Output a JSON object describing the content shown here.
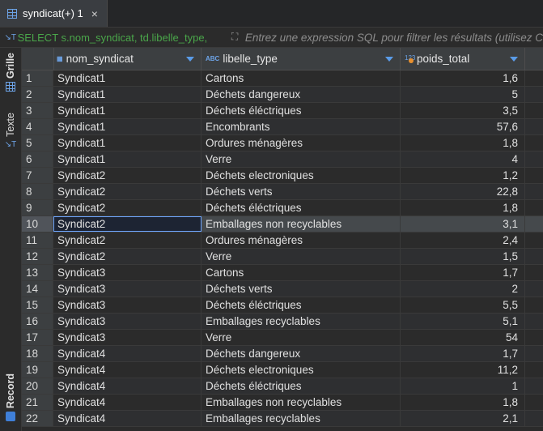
{
  "tab": {
    "title": "syndicat(+) 1",
    "close": "×"
  },
  "filter": {
    "sql": "SELECT s.nom_syndicat, td.libelle_type,",
    "placeholder": "Entrez une expression SQL pour filtrer les résultats (utilisez C"
  },
  "rail": {
    "grid_label": "Grille",
    "text_label": "Texte",
    "record_label": "Record"
  },
  "columns": [
    {
      "name": "nom_syndicat",
      "type_badge": ""
    },
    {
      "name": "libelle_type",
      "type_badge": "ABC"
    },
    {
      "name": "poids_total",
      "type_badge": "123"
    }
  ],
  "rows": [
    {
      "n": "1",
      "syndicat": "Syndicat1",
      "type": "Cartons",
      "poids": "1,6"
    },
    {
      "n": "2",
      "syndicat": "Syndicat1",
      "type": "Déchets dangereux",
      "poids": "5"
    },
    {
      "n": "3",
      "syndicat": "Syndicat1",
      "type": "Déchets éléctriques",
      "poids": "3,5"
    },
    {
      "n": "4",
      "syndicat": "Syndicat1",
      "type": "Encombrants",
      "poids": "57,6"
    },
    {
      "n": "5",
      "syndicat": "Syndicat1",
      "type": "Ordures ménagères",
      "poids": "1,8"
    },
    {
      "n": "6",
      "syndicat": "Syndicat1",
      "type": "Verre",
      "poids": "4"
    },
    {
      "n": "7",
      "syndicat": "Syndicat2",
      "type": "Déchets electroniques",
      "poids": "1,2"
    },
    {
      "n": "8",
      "syndicat": "Syndicat2",
      "type": "Déchets verts",
      "poids": "22,8"
    },
    {
      "n": "9",
      "syndicat": "Syndicat2",
      "type": "Déchets éléctriques",
      "poids": "1,8"
    },
    {
      "n": "10",
      "syndicat": "Syndicat2",
      "type": "Emballages non recyclables",
      "poids": "3,1"
    },
    {
      "n": "11",
      "syndicat": "Syndicat2",
      "type": "Ordures ménagères",
      "poids": "2,4"
    },
    {
      "n": "12",
      "syndicat": "Syndicat2",
      "type": "Verre",
      "poids": "1,5"
    },
    {
      "n": "13",
      "syndicat": "Syndicat3",
      "type": "Cartons",
      "poids": "1,7"
    },
    {
      "n": "14",
      "syndicat": "Syndicat3",
      "type": "Déchets verts",
      "poids": "2"
    },
    {
      "n": "15",
      "syndicat": "Syndicat3",
      "type": "Déchets éléctriques",
      "poids": "5,5"
    },
    {
      "n": "16",
      "syndicat": "Syndicat3",
      "type": "Emballages recyclables",
      "poids": "5,1"
    },
    {
      "n": "17",
      "syndicat": "Syndicat3",
      "type": "Verre",
      "poids": "54"
    },
    {
      "n": "18",
      "syndicat": "Syndicat4",
      "type": "Déchets dangereux",
      "poids": "1,7"
    },
    {
      "n": "19",
      "syndicat": "Syndicat4",
      "type": "Déchets electroniques",
      "poids": "11,2"
    },
    {
      "n": "20",
      "syndicat": "Syndicat4",
      "type": "Déchets éléctriques",
      "poids": "1"
    },
    {
      "n": "21",
      "syndicat": "Syndicat4",
      "type": "Emballages non recyclables",
      "poids": "1,8"
    },
    {
      "n": "22",
      "syndicat": "Syndicat4",
      "type": "Emballages recyclables",
      "poids": "2,1"
    }
  ],
  "selected_row": "10"
}
